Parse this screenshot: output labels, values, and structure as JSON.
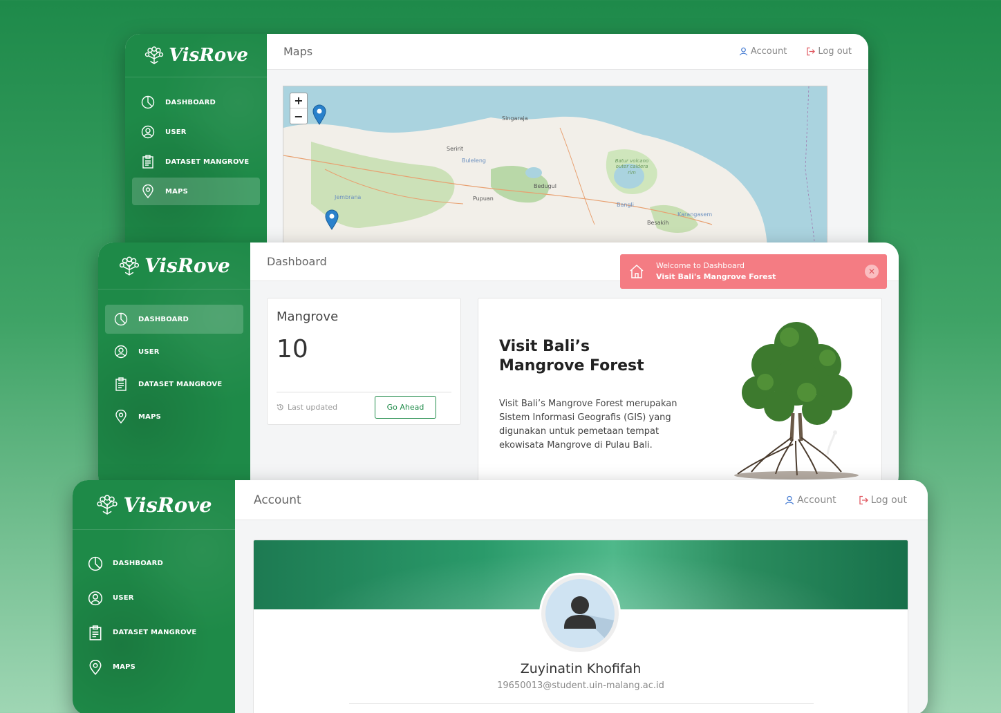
{
  "brand": "VisRove",
  "nav": {
    "dashboard": "DASHBOARD",
    "user": "USER",
    "dataset": "DATASET MANGROVE",
    "maps": "MAPS"
  },
  "header_links": {
    "account": "Account",
    "logout": "Log out"
  },
  "maps_window": {
    "title": "Maps",
    "zoom_in": "+",
    "zoom_out": "−",
    "places": [
      "Singaraja",
      "Seririt",
      "Buleleng",
      "Batur volcano outer caldera rim",
      "Bedugul",
      "Jembrana",
      "Pupuan",
      "Bangli",
      "Besakih",
      "Karangasem"
    ]
  },
  "dashboard_window": {
    "title": "Dashboard",
    "toast": {
      "line1": "Welcome to Dashboard",
      "line2": "Visit Bali's Mangrove Forest",
      "close": "✕"
    },
    "stat": {
      "title": "Mangrove",
      "value": "10",
      "updated": "Last updated",
      "button": "Go Ahead"
    },
    "hero": {
      "heading": "Visit Bali’s Mangrove Forest",
      "body": "Visit Bali’s Mangrove Forest merupakan Sistem Informasi Geografis (GIS) yang digunakan untuk pemetaan tempat ekowisata Mangrove di Pulau Bali."
    }
  },
  "account_window": {
    "title": "Account",
    "profile": {
      "name": "Zuyinatin Khofifah",
      "email": "19650013@student.uin-malang.ac.id"
    }
  },
  "colors": {
    "brand_green": "#1e8a48",
    "toast": "#f47c83",
    "link_blue": "#4a7fd4"
  }
}
